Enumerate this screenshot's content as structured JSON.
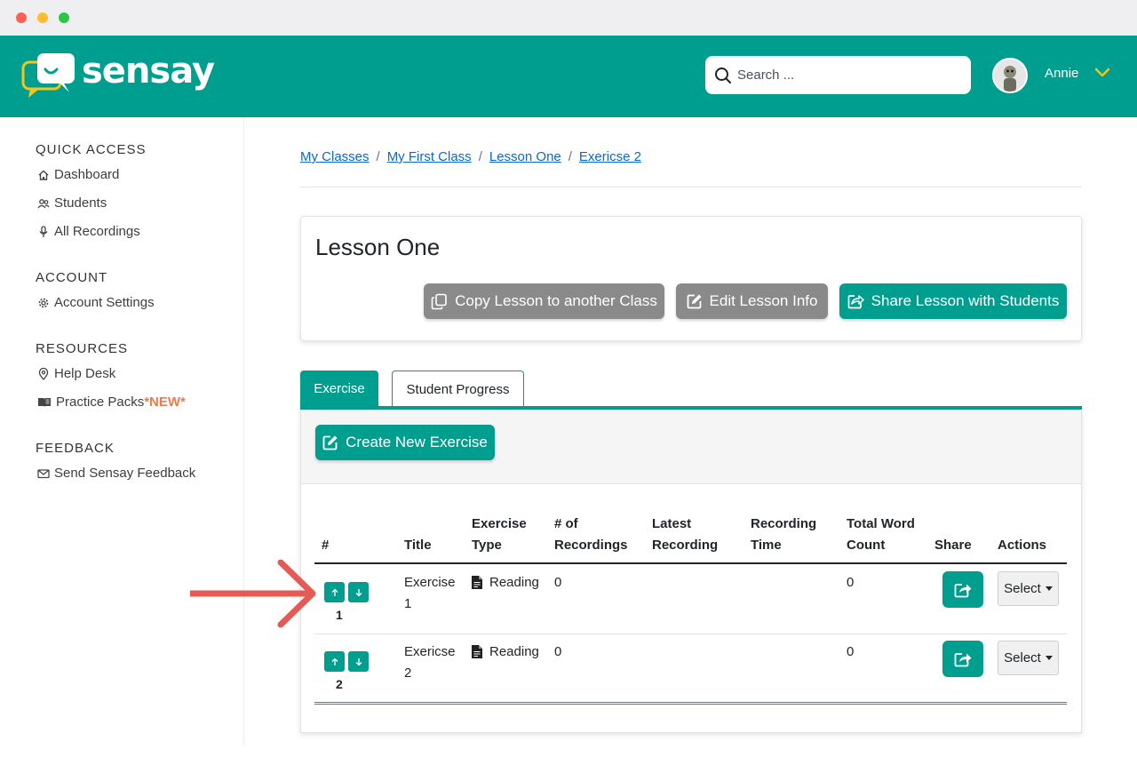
{
  "brand": {
    "name": "sensay",
    "accent": "#009e8f"
  },
  "search": {
    "placeholder": "Search ..."
  },
  "user": {
    "name": "Annie"
  },
  "sidebar": {
    "sections": [
      {
        "title": "QUICK ACCESS",
        "items": [
          {
            "label": "Dashboard",
            "icon": "home-icon"
          },
          {
            "label": "Students",
            "icon": "users-icon"
          },
          {
            "label": "All Recordings",
            "icon": "microphone-icon"
          }
        ]
      },
      {
        "title": "ACCOUNT",
        "items": [
          {
            "label": "Account Settings",
            "icon": "gear-icon"
          }
        ]
      },
      {
        "title": "RESOURCES",
        "items": [
          {
            "label": "Help Desk",
            "icon": "location-pin-icon"
          },
          {
            "label": "Practice Packs",
            "badge": "*NEW*",
            "icon": "book-icon"
          }
        ]
      },
      {
        "title": "FEEDBACK",
        "items": [
          {
            "label": "Send Sensay Feedback",
            "icon": "envelope-icon"
          }
        ]
      }
    ]
  },
  "breadcrumb": [
    "My Classes",
    "My First Class",
    "Lesson One",
    "Exericse 2"
  ],
  "breadcrumb_separator": "/",
  "lesson": {
    "title": "Lesson One",
    "copy_label": "Copy Lesson to another Class",
    "edit_label": "Edit Lesson Info",
    "share_label": "Share Lesson with Students"
  },
  "tabs": {
    "exercise": "Exercise",
    "progress": "Student Progress"
  },
  "create_label": "Create New Exercise",
  "table": {
    "headers": {
      "num": "#",
      "title": "Title",
      "type_1": "Exercise",
      "type_2": "Type",
      "recs_1": "# of",
      "recs_2": "Recordings",
      "latest_1": "Latest",
      "latest_2": "Recording",
      "time_1": "Recording",
      "time_2": "Time",
      "words_1": "Total Word",
      "words_2": "Count",
      "share": "Share",
      "actions": "Actions"
    },
    "rows": [
      {
        "index": "1",
        "title_1": "Exercise",
        "title_2": "1",
        "type": "Reading",
        "recordings": "0",
        "latest": "",
        "time": "",
        "words": "0",
        "action": "Select"
      },
      {
        "index": "2",
        "title_1": "Exericse",
        "title_2": "2",
        "type": "Reading",
        "recordings": "0",
        "latest": "",
        "time": "",
        "words": "0",
        "action": "Select"
      }
    ]
  },
  "annotation": {
    "color": "#e65a56"
  }
}
